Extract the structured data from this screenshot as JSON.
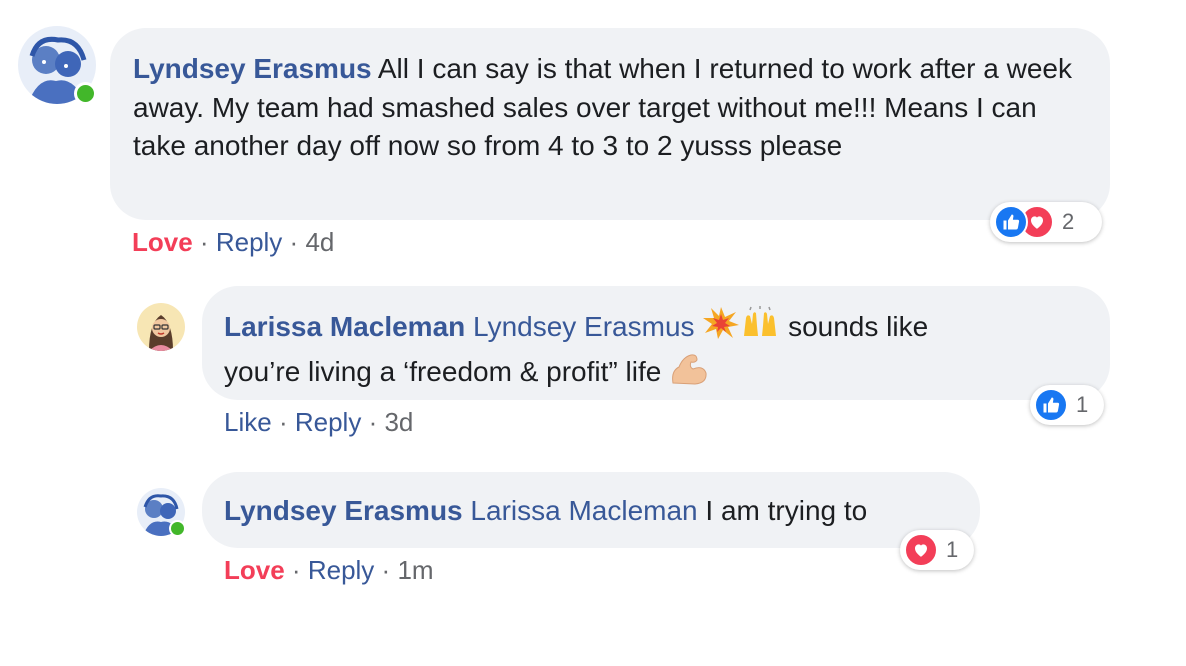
{
  "comments": [
    {
      "author": "Lyndsey Erasmus",
      "text": "All I can say is that when I returned to work after a week away. My team had smashed sales over target without me!!! Means I can take another day off now so from 4 to 3 to 2 yusss please",
      "react_action": "Love",
      "reply_label": "Reply",
      "separator": "·",
      "time": "4d",
      "reaction_count": "2",
      "reactions": [
        "like-icon",
        "love-icon"
      ],
      "online": true
    },
    {
      "author": "Larissa Macleman",
      "mention": "Lyndsey Erasmus",
      "emojis_before": [
        "collision-emoji",
        "raising-hands-emoji"
      ],
      "text_line1": "sounds like",
      "text_line2": "you’re living a ‘freedom & profit” life",
      "emojis_after": [
        "flexed-biceps-emoji"
      ],
      "react_action": "Like",
      "reply_label": "Reply",
      "separator": "·",
      "time": "3d",
      "reaction_count": "1",
      "reactions": [
        "like-icon"
      ]
    },
    {
      "author": "Lyndsey Erasmus",
      "mention": "Larissa Macleman",
      "text": "I am trying to",
      "react_action": "Love",
      "reply_label": "Reply",
      "separator": "·",
      "time": "1m",
      "reaction_count": "1",
      "reactions": [
        "love-icon"
      ],
      "online": true
    }
  ],
  "colors": {
    "bubble": "#f0f2f5",
    "link": "#385898",
    "love": "#f33e58",
    "like": "#1877f2",
    "online": "#42b72a",
    "muted": "#65676b"
  }
}
